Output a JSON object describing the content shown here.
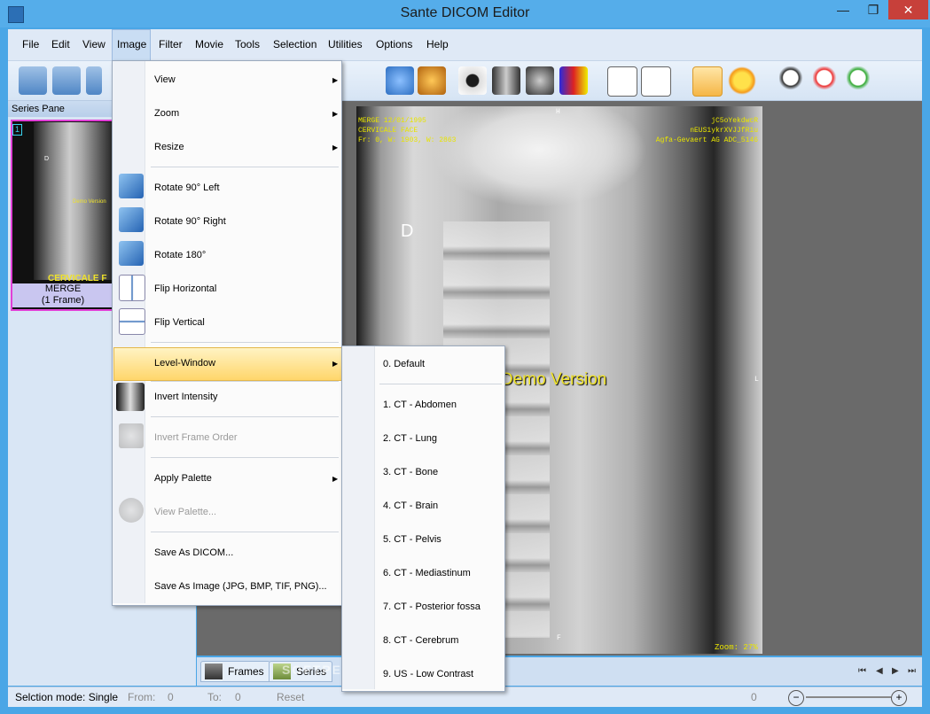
{
  "window": {
    "title": "Sante DICOM Editor",
    "minimize": "—",
    "maximize": "❐",
    "close": "✕"
  },
  "menubar": {
    "items": [
      "File",
      "Edit",
      "View",
      "Image",
      "Filter",
      "Movie",
      "Tools",
      "Selection",
      "Utilities",
      "Options",
      "Help"
    ]
  },
  "series_pane": {
    "header": "Series Pane",
    "thumb_index": "1",
    "thumb_overlay": "CERVICALE F",
    "thumb_demo": "Demo Version",
    "thumb_marker": "D",
    "thumb_label_1": "MERGE",
    "thumb_label_2": "(1 Frame)"
  },
  "viewer": {
    "overlay_top_left": [
      "MERGE 12/01/1995",
      "CERVICALE FACE",
      "Fr: 0, W: 1903, W: 2863"
    ],
    "overlay_top_right": [
      "jC5oYekdwcR",
      "nEUS1ykrXVJJfR1u",
      "Agfa-Gevaert AG ADC_5146"
    ],
    "marker_top": "H",
    "marker_left": "D",
    "marker_right": "L",
    "marker_bottom": "F",
    "demo_text": "Demo Version",
    "zoom": "Zoom: 27%"
  },
  "image_menu": {
    "items": [
      {
        "label": "View",
        "has_submenu": true
      },
      {
        "label": "Zoom",
        "has_submenu": true
      },
      {
        "label": "Resize",
        "has_submenu": true
      },
      {
        "label": "Rotate 90° Left"
      },
      {
        "label": "Rotate 90° Right"
      },
      {
        "label": "Rotate 180°"
      },
      {
        "label": "Flip Horizontal"
      },
      {
        "label": "Flip Vertical"
      },
      {
        "label": "Level-Window",
        "has_submenu": true,
        "highlighted": true
      },
      {
        "label": "Invert Intensity"
      },
      {
        "label": "Invert Frame Order",
        "disabled": true
      },
      {
        "label": "Apply Palette",
        "has_submenu": true
      },
      {
        "label": "View Palette...",
        "disabled": true
      },
      {
        "label": "Save As DICOM..."
      },
      {
        "label": "Save As Image (JPG, BMP, TIF, PNG)..."
      }
    ]
  },
  "level_window_menu": {
    "items": [
      "0. Default",
      "1. CT - Abdomen",
      "2. CT - Lung",
      "3. CT - Bone",
      "4. CT - Brain",
      "5. CT - Pelvis",
      "6. CT - Mediastinum",
      "7. CT - Posterior fossa",
      "8. CT - Cerebrum",
      "9. US - Low Contrast"
    ]
  },
  "bottom_tabs": {
    "frames": "Frames",
    "series": "Series",
    "watermark": "SOFTPEDIA"
  },
  "statusbar": {
    "selection_mode": "Selction mode: Single",
    "from_label": "From:",
    "from_value": "0",
    "to_label": "To:",
    "to_value": "0",
    "reset": "Reset",
    "zoom_value": "0"
  },
  "colors": {
    "titlebar": "#55adea",
    "menu_highlight": "#ffd66b",
    "thumb_border": "#e13fd6",
    "overlay_text": "#e8e400"
  }
}
